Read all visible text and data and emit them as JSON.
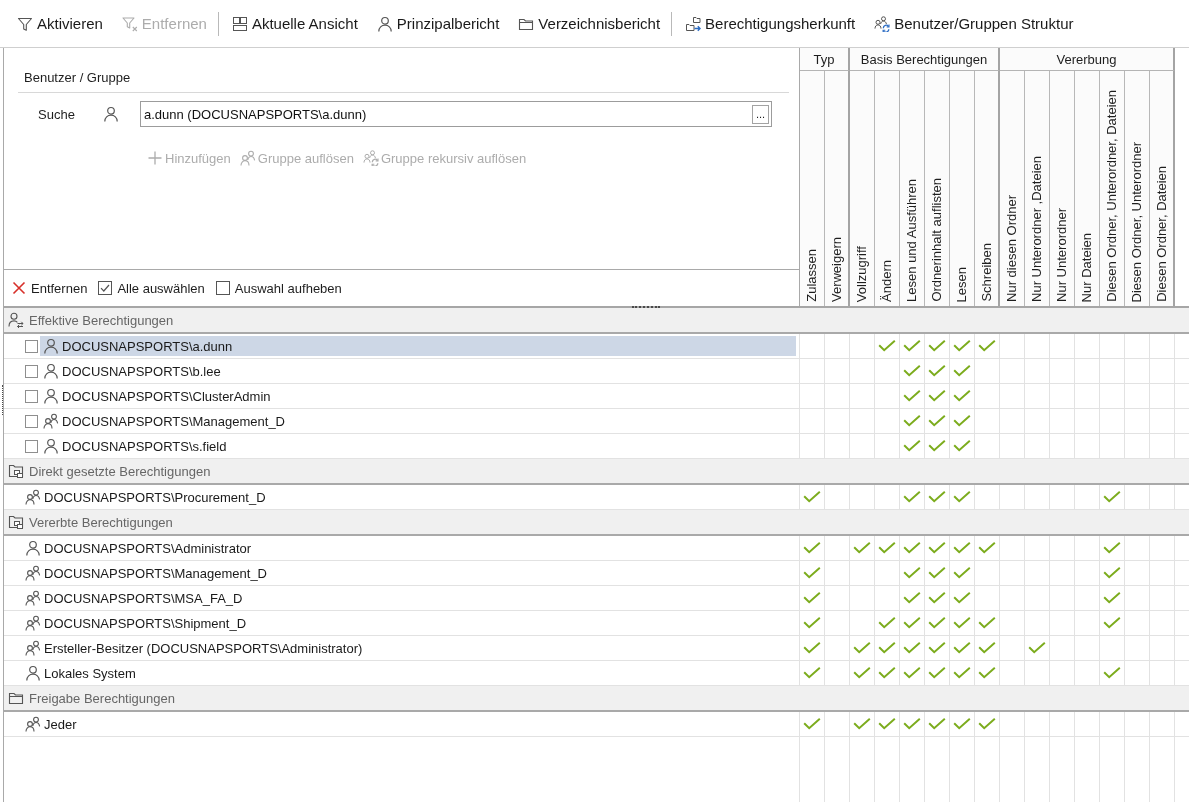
{
  "toolbar": {
    "groups": [
      {
        "buttons": [
          {
            "label": "Aktivieren",
            "disabled": false
          },
          {
            "label": "Entfernen",
            "disabled": true
          }
        ]
      },
      {
        "buttons": [
          {
            "label": "Aktuelle Ansicht",
            "disabled": false
          },
          {
            "label": "Prinzipalbericht",
            "disabled": false
          },
          {
            "label": "Verzeichnisbericht",
            "disabled": false
          }
        ]
      },
      {
        "buttons": [
          {
            "label": "Berechtigungsherkunft",
            "disabled": false
          },
          {
            "label": "Benutzer/Gruppen Struktur",
            "disabled": false
          }
        ]
      }
    ]
  },
  "principal_panel": {
    "title": "Benutzer / Gruppe",
    "search": {
      "label": "Suche",
      "value": "a.dunn (DOCUSNAPSPORTS\\a.dunn)",
      "browse_button": "..."
    },
    "actions": [
      {
        "label": "Hinzufügen",
        "disabled": true
      },
      {
        "label": "Gruppe auflösen",
        "disabled": true
      },
      {
        "label": "Gruppe rekursiv auflösen",
        "disabled": true
      }
    ],
    "list_actions": [
      {
        "label": "Entfernen",
        "disabled": false
      },
      {
        "label": "Alle auswählen",
        "disabled": false
      },
      {
        "label": "Auswahl aufheben",
        "disabled": false
      }
    ]
  },
  "column_groups": [
    {
      "title": "Typ",
      "columns": [
        "Zulassen",
        "Verweigern"
      ]
    },
    {
      "title": "Basis Berechtigungen",
      "columns": [
        "Vollzugriff",
        "Ändern",
        "Lesen und Ausführen",
        "Ordnerinhalt auflisten",
        "Lesen",
        "Schreiben"
      ]
    },
    {
      "title": "Vererbung",
      "columns": [
        "Nur diesen Ordner",
        "Nur Unterordner ,Dateien",
        "Nur Unterordner",
        "Nur Dateien",
        "Diesen Ordner, Unterordner, Dateien",
        "Diesen Ordner, Unterordner",
        "Diesen Ordner, Dateien"
      ]
    }
  ],
  "sections": [
    {
      "title": "Effektive Berechtigungen",
      "rows": [
        {
          "name": "DOCUSNAPSPORTS\\a.dunn",
          "kind": "user",
          "checked": false,
          "selected": true,
          "permissions": [
            false,
            false,
            false,
            true,
            true,
            true,
            true,
            true,
            false,
            false,
            false,
            false,
            false,
            false,
            false
          ]
        },
        {
          "name": "DOCUSNAPSPORTS\\b.lee",
          "kind": "user",
          "checked": false,
          "selected": false,
          "permissions": [
            false,
            false,
            false,
            false,
            true,
            true,
            true,
            false,
            false,
            false,
            false,
            false,
            false,
            false,
            false
          ]
        },
        {
          "name": "DOCUSNAPSPORTS\\ClusterAdmin",
          "kind": "user",
          "checked": false,
          "selected": false,
          "permissions": [
            false,
            false,
            false,
            false,
            true,
            true,
            true,
            false,
            false,
            false,
            false,
            false,
            false,
            false,
            false
          ]
        },
        {
          "name": "DOCUSNAPSPORTS\\Management_D",
          "kind": "group",
          "checked": false,
          "selected": false,
          "permissions": [
            false,
            false,
            false,
            false,
            true,
            true,
            true,
            false,
            false,
            false,
            false,
            false,
            false,
            false,
            false
          ]
        },
        {
          "name": "DOCUSNAPSPORTS\\s.field",
          "kind": "user",
          "checked": false,
          "selected": false,
          "permissions": [
            false,
            false,
            false,
            false,
            true,
            true,
            true,
            false,
            false,
            false,
            false,
            false,
            false,
            false,
            false
          ]
        }
      ]
    },
    {
      "title": "Direkt gesetzte Berechtigungen",
      "rows": [
        {
          "name": "DOCUSNAPSPORTS\\Procurement_D",
          "kind": "group",
          "selected": false,
          "permissions": [
            true,
            false,
            false,
            false,
            true,
            true,
            true,
            false,
            false,
            false,
            false,
            false,
            true,
            false,
            false
          ]
        }
      ]
    },
    {
      "title": "Vererbte Berechtigungen",
      "rows": [
        {
          "name": "DOCUSNAPSPORTS\\Administrator",
          "kind": "user",
          "selected": false,
          "permissions": [
            true,
            false,
            true,
            true,
            true,
            true,
            true,
            true,
            false,
            false,
            false,
            false,
            true,
            false,
            false
          ]
        },
        {
          "name": "DOCUSNAPSPORTS\\Management_D",
          "kind": "group",
          "selected": false,
          "permissions": [
            true,
            false,
            false,
            false,
            true,
            true,
            true,
            false,
            false,
            false,
            false,
            false,
            true,
            false,
            false
          ]
        },
        {
          "name": "DOCUSNAPSPORTS\\MSA_FA_D",
          "kind": "group",
          "selected": false,
          "permissions": [
            true,
            false,
            false,
            false,
            true,
            true,
            true,
            false,
            false,
            false,
            false,
            false,
            true,
            false,
            false
          ]
        },
        {
          "name": "DOCUSNAPSPORTS\\Shipment_D",
          "kind": "group",
          "selected": false,
          "permissions": [
            true,
            false,
            false,
            true,
            true,
            true,
            true,
            true,
            false,
            false,
            false,
            false,
            true,
            false,
            false
          ]
        },
        {
          "name": "Ersteller-Besitzer (DOCUSNAPSPORTS\\Administrator)",
          "kind": "group",
          "selected": false,
          "permissions": [
            true,
            false,
            true,
            true,
            true,
            true,
            true,
            true,
            false,
            true,
            false,
            false,
            false,
            false,
            false
          ]
        },
        {
          "name": "Lokales System",
          "kind": "user",
          "selected": false,
          "permissions": [
            true,
            false,
            true,
            true,
            true,
            true,
            true,
            true,
            false,
            false,
            false,
            false,
            true,
            false,
            false
          ]
        }
      ]
    },
    {
      "title": "Freigabe Berechtigungen",
      "rows": [
        {
          "name": "Jeder",
          "kind": "group",
          "selected": false,
          "permissions": [
            true,
            false,
            true,
            true,
            true,
            true,
            true,
            true,
            false,
            false,
            false,
            false,
            false,
            false,
            false
          ]
        }
      ]
    }
  ]
}
